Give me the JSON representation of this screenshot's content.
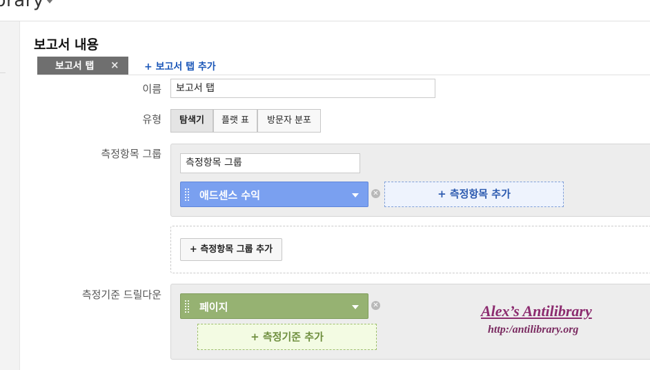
{
  "header": {
    "title": "brary"
  },
  "section": {
    "title": "보고서 내용"
  },
  "tabs": {
    "active_label": "보고서 탭",
    "close_glyph": "×",
    "add_label": "+ 보고서 탭 추가"
  },
  "form": {
    "name_label": "이름",
    "name_value": "보고서 탭",
    "type_label": "유형",
    "type_options": [
      "탐색기",
      "플랫 표",
      "방문자 분포"
    ],
    "type_selected": "탐색기",
    "metric_group_label": "측정항목 그룹",
    "metric_group_name": "측정항목 그룹",
    "metric_chip": "애드센스 수익",
    "add_metric": "+ 측정항목 추가",
    "add_group": "+ 측정항목 그룹 추가",
    "drilldown_label": "측정기준 드릴다운",
    "dimension_chip": "페이지",
    "add_dimension": "+ 측정기준 추가"
  },
  "watermark": {
    "title": "Alex’s Antilibrary",
    "url": "http:/antilibrary.org"
  },
  "colors": {
    "metric_chip": "#7aa0f0",
    "dimension_chip": "#96b272",
    "link": "#1a56b8",
    "watermark": "#8b2a6e"
  },
  "icons": [
    "chevron-down-icon",
    "close-icon",
    "drag-handle-icon",
    "remove-circle-icon"
  ]
}
